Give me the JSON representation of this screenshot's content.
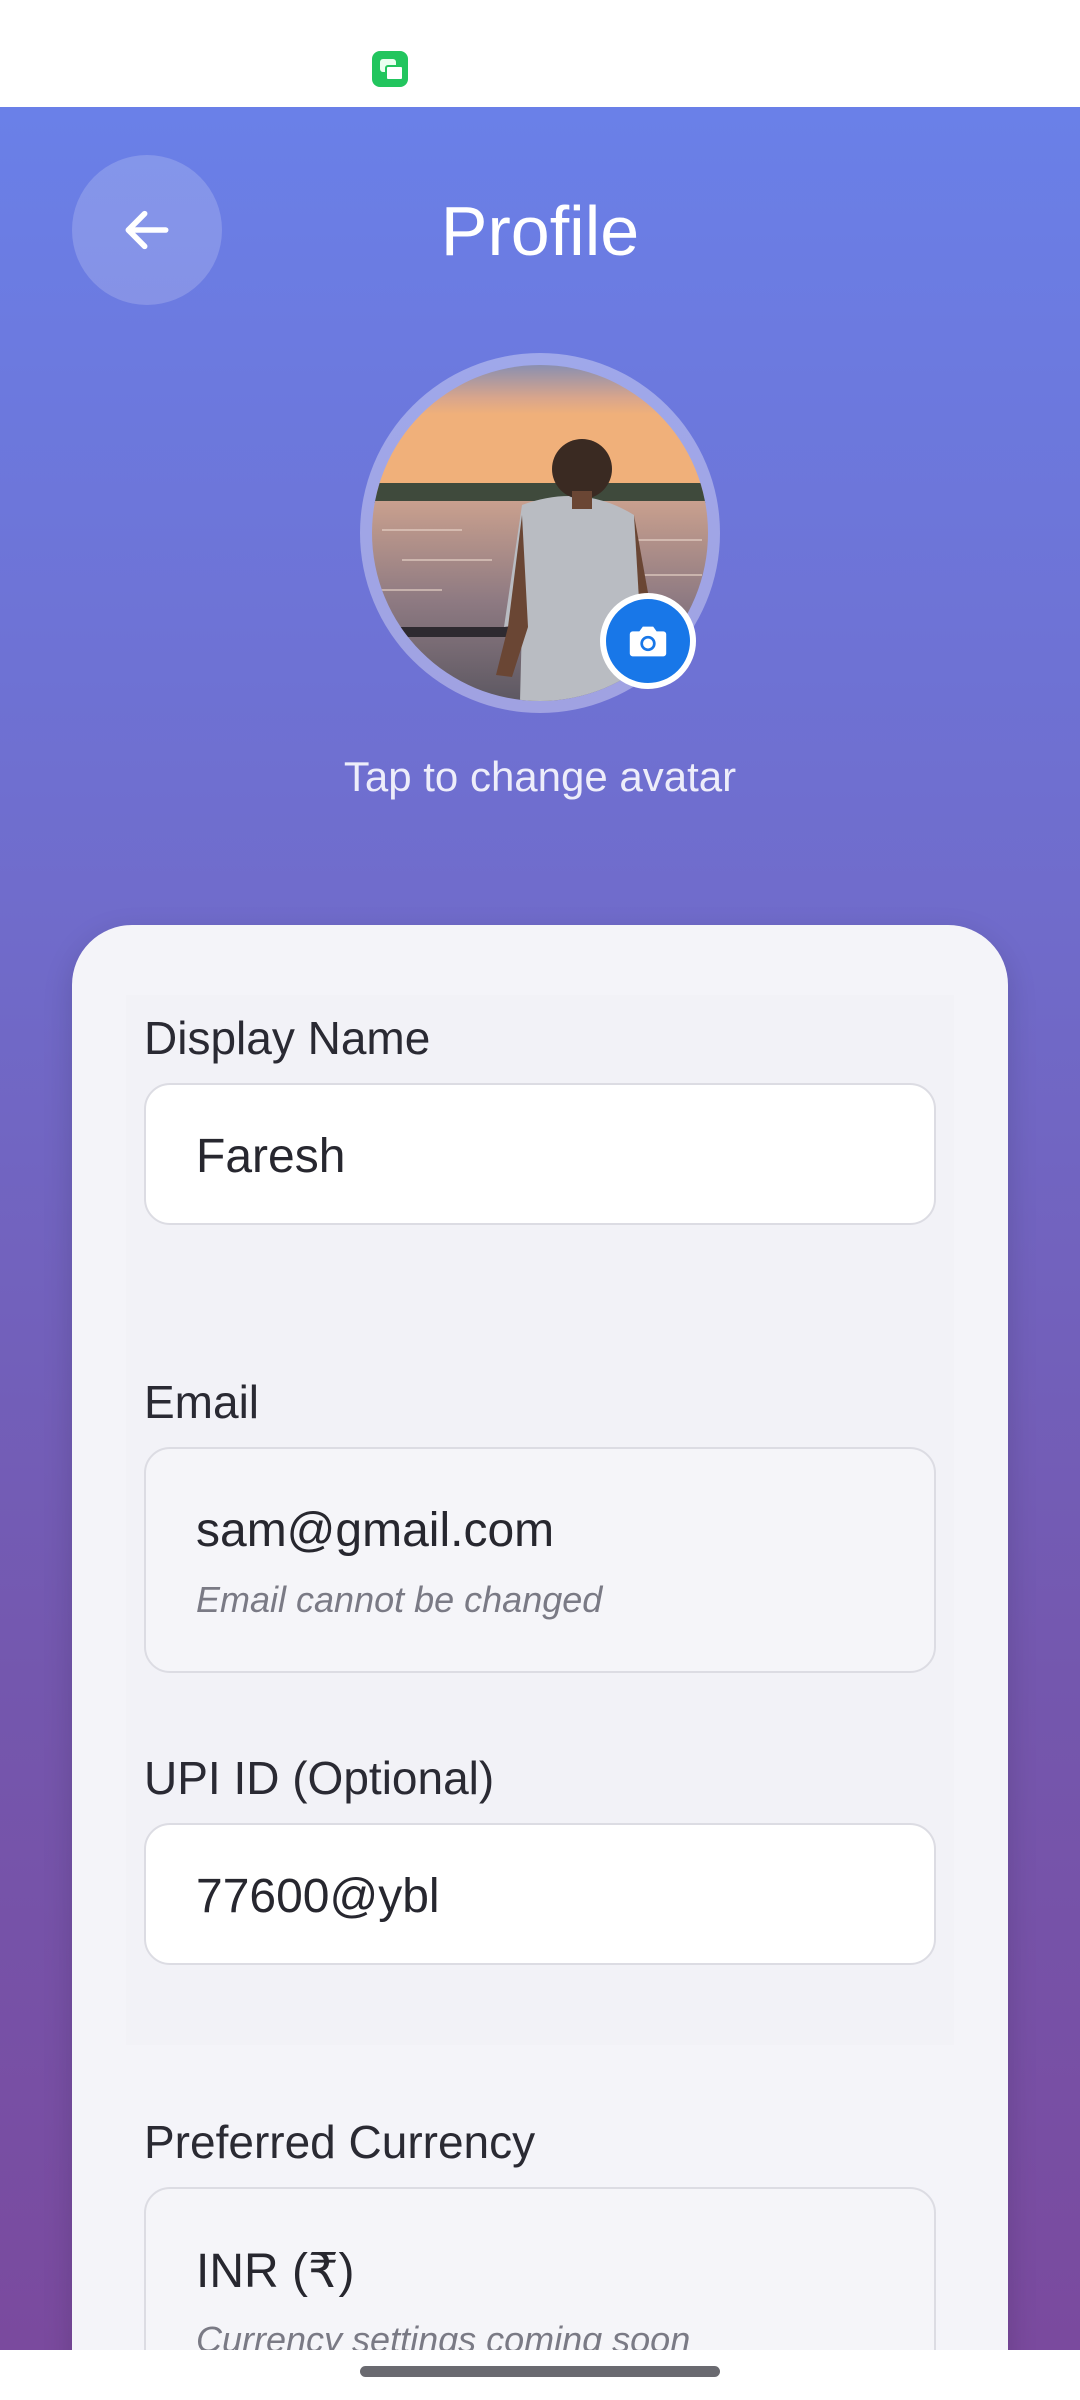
{
  "header": {
    "title": "Profile",
    "back_icon": "arrow-left-icon"
  },
  "avatar": {
    "hint": "Tap to change avatar",
    "camera_icon": "camera-icon"
  },
  "form": {
    "display_name": {
      "label": "Display Name",
      "value": "Faresh"
    },
    "email": {
      "label": "Email",
      "value": "sam@gmail.com",
      "hint": "Email cannot be changed"
    },
    "upi": {
      "label": "UPI ID (Optional)",
      "value": "77600@ybl"
    },
    "currency": {
      "label": "Preferred Currency",
      "value": "INR (₹)",
      "hint": "Currency settings coming soon"
    }
  },
  "colors": {
    "gradient_top": "#6a80e8",
    "gradient_bottom": "#7a4a9e",
    "camera_button": "#1877e8",
    "status_app_icon": "#22c55e"
  }
}
